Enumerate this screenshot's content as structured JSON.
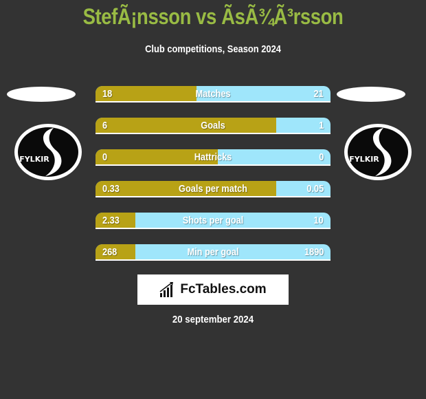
{
  "header": {
    "title": "StefÃ¡nsson vs ÃsÃ¾Ã³rsson",
    "subtitle": "Club competitions, Season 2024"
  },
  "teams": {
    "left": {
      "logo_text": "FYLKIR",
      "logo_icon": "fylkir-crest-icon"
    },
    "right": {
      "logo_text": "FYLKIR",
      "logo_icon": "fylkir-crest-icon"
    }
  },
  "colors": {
    "left_bar": "#b8a216",
    "right_bar": "#9fe6fb",
    "title": "#99bb44",
    "background": "#333333"
  },
  "stats": [
    {
      "label": "Matches",
      "left": "18",
      "right": "21",
      "left_share": 0.43
    },
    {
      "label": "Goals",
      "left": "6",
      "right": "1",
      "left_share": 0.77
    },
    {
      "label": "Hattricks",
      "left": "0",
      "right": "0",
      "left_share": 0.52
    },
    {
      "label": "Goals per match",
      "left": "0.33",
      "right": "0.05",
      "left_share": 0.77
    },
    {
      "label": "Shots per goal",
      "left": "2.33",
      "right": "10",
      "left_share": 0.17
    },
    {
      "label": "Min per goal",
      "left": "268",
      "right": "1890",
      "left_share": 0.17
    }
  ],
  "brand": {
    "text": "FcTables.com",
    "icon": "bar-chart-icon"
  },
  "date": "20 september 2024"
}
